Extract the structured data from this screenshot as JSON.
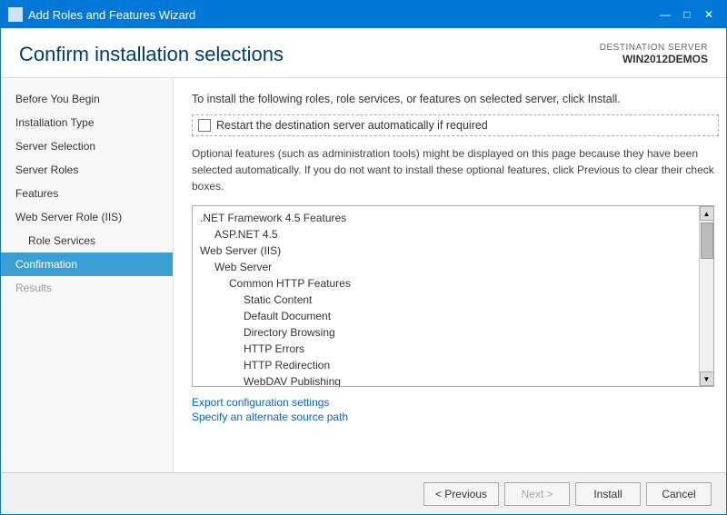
{
  "window": {
    "title": "Add Roles and Features Wizard",
    "icon": "🖥"
  },
  "title_bar_controls": {
    "minimize": "—",
    "maximize": "□",
    "close": "✕"
  },
  "header": {
    "page_title": "Confirm installation selections",
    "dest_server_label": "DESTINATION SERVER",
    "dest_server_name": "WIN2012DEMOS"
  },
  "sidebar": {
    "items": [
      {
        "label": "Before You Begin",
        "level": 0,
        "state": "normal"
      },
      {
        "label": "Installation Type",
        "level": 0,
        "state": "normal"
      },
      {
        "label": "Server Selection",
        "level": 0,
        "state": "normal"
      },
      {
        "label": "Server Roles",
        "level": 0,
        "state": "normal"
      },
      {
        "label": "Features",
        "level": 0,
        "state": "normal"
      },
      {
        "label": "Web Server Role (IIS)",
        "level": 0,
        "state": "normal"
      },
      {
        "label": "Role Services",
        "level": 1,
        "state": "normal"
      },
      {
        "label": "Confirmation",
        "level": 0,
        "state": "active"
      },
      {
        "label": "Results",
        "level": 0,
        "state": "disabled"
      }
    ]
  },
  "main": {
    "instruction": "To install the following roles, role services, or features on selected server, click Install.",
    "checkbox_label": "Restart the destination server automatically if required",
    "checkbox_checked": false,
    "optional_text": "Optional features (such as administration tools) might be displayed on this page because they have been selected automatically. If you do not want to install these optional features, click Previous to clear their check boxes.",
    "features": [
      {
        "label": ".NET Framework 4.5 Features",
        "indent": 0
      },
      {
        "label": "ASP.NET 4.5",
        "indent": 1
      },
      {
        "label": "Web Server (IIS)",
        "indent": 0
      },
      {
        "label": "Web Server",
        "indent": 1
      },
      {
        "label": "Common HTTP Features",
        "indent": 2
      },
      {
        "label": "Static Content",
        "indent": 3
      },
      {
        "label": "Default Document",
        "indent": 3
      },
      {
        "label": "Directory Browsing",
        "indent": 3
      },
      {
        "label": "HTTP Errors",
        "indent": 3
      },
      {
        "label": "HTTP Redirection",
        "indent": 3
      },
      {
        "label": "WebDAV Publishing",
        "indent": 3
      }
    ],
    "links": [
      {
        "label": "Export configuration settings"
      },
      {
        "label": "Specify an alternate source path"
      }
    ]
  },
  "footer": {
    "previous_label": "< Previous",
    "next_label": "Next >",
    "install_label": "Install",
    "cancel_label": "Cancel"
  }
}
